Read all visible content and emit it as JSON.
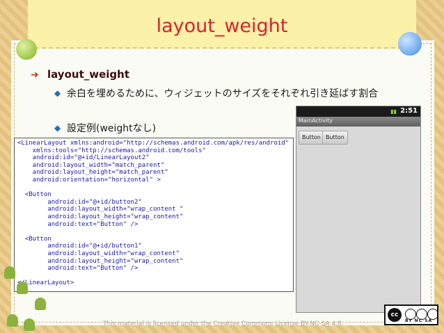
{
  "slide": {
    "title": "layout_weight",
    "bullet_main": "layout_weight",
    "bullet_sub1": "余白を埋めるために、ウィジェットのサイズをそれぞれ引き延ばす割合",
    "bullet_sub2": "設定例(weightなし)"
  },
  "code_lines": [
    "<LinearLayout xmlns:android=\"http://schemas.android.com/apk/res/android\"",
    "    xmlns:tools=\"http://schemas.android.com/tools\"",
    "    android:id=\"@+id/LinearLayout2\"",
    "    android:layout_width=\"match_parent\"",
    "    android:layout_height=\"match_parent\"",
    "    android:orientation=\"horizontal\" >",
    "",
    "  <Button",
    "        android:id=\"@+id/button2\"",
    "        android:layout_width=\"wrap_content \"",
    "        android:layout_height=\"wrap_content\"",
    "        android:text=\"Button\" />",
    "",
    "  <Button",
    "        android:id=\"@+id/button1\"",
    "        android:layout_width=\"wrap_content\"",
    "        android:layout_height=\"wrap_content\"",
    "        android:text=\"Button\" />",
    "",
    "</LinearLayout>"
  ],
  "phone": {
    "clock": "2:51",
    "app_title": "MainActivity",
    "button1_label": "Button",
    "button2_label": "Button"
  },
  "footer": {
    "license_text": "This material is licensed under the Creative Commons License BY-NC-SA 4.0.",
    "cc_logo_text": "cc",
    "cc_badges": "BY  NC  SA"
  },
  "colors": {
    "title_red": "#d7222e",
    "banner_yellow": "#fbf1a8",
    "code_blue": "#1a1aa0"
  },
  "icons": {
    "main_bullet": "arrow-bullet-icon",
    "sub_bullet": "diamond-bullet-icon"
  }
}
